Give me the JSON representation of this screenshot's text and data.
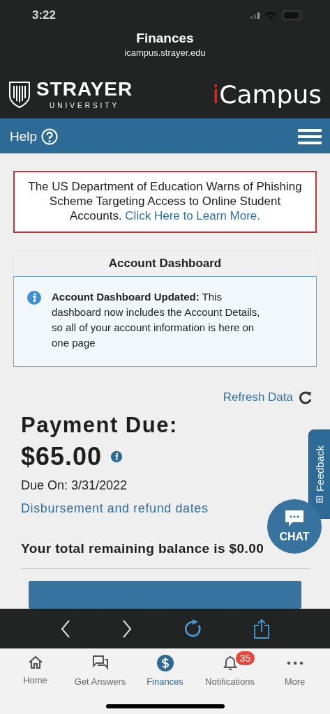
{
  "status_bar": {
    "time": "3:22"
  },
  "browser": {
    "title": "Finances",
    "url": "icampus.strayer.edu"
  },
  "header": {
    "brand": "STRAYER",
    "brand_sub": "UNIVERSITY",
    "app_logo": "iCampus"
  },
  "nav_bar": {
    "help": "Help"
  },
  "alert": {
    "text": "The US Department of Education Warns of Phishing Scheme Targeting Access to Online Student Accounts.",
    "link": "Click Here to Learn More."
  },
  "dashboard": {
    "title": "Account Dashboard",
    "notice": "**Account Dashboard Updated:** This dashboard now includes the Account Details, so all of your account information is here on one page"
  },
  "feedback": "Feedback",
  "refresh": "Refresh Data",
  "payment": {
    "label": "Payment Due:",
    "amount": "$65.00",
    "due_on": "Due On: 3/31/2022",
    "link": "Disbursement and refund dates",
    "balance": "Your total remaining balance is $0.00"
  },
  "chat": "CHAT",
  "tabs": [
    {
      "label": "Home",
      "selected": false
    },
    {
      "label": "Get Answers",
      "selected": false
    },
    {
      "label": "Finances",
      "selected": true
    },
    {
      "label": "Notifications",
      "selected": false,
      "badge": "35"
    },
    {
      "label": "More",
      "selected": false
    }
  ]
}
